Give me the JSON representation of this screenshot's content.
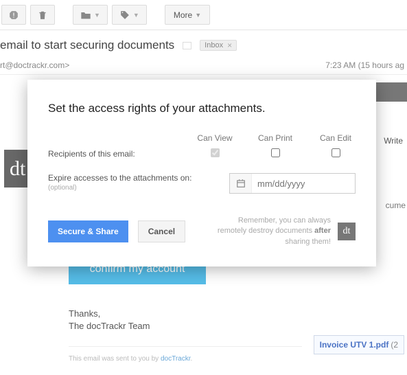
{
  "toolbar": {
    "more_label": "More"
  },
  "email": {
    "subject_fragment": "email to start securing documents",
    "inbox_label": "Inbox",
    "from_fragment": "rt@doctrackr.com>",
    "time_fragment": "7:23 AM (15 hours ag"
  },
  "right_rail": {
    "write_fragment": "Write",
    "cume_fragment": "cume"
  },
  "body": {
    "confirm_label": "confirm my account",
    "thanks_line1": "Thanks,",
    "thanks_line2": "The docTrackr Team",
    "footer_prefix": "This email was sent to you by ",
    "footer_link": "docTrackr",
    "footer_suffix": "."
  },
  "attachment": {
    "name": "Invoice UTV 1.pdf",
    "rest": "(2"
  },
  "modal": {
    "title": "Set the access rights of your attachments.",
    "col_view": "Can View",
    "col_print": "Can Print",
    "col_edit": "Can Edit",
    "recipients_label": "Recipients of this email:",
    "perm_view": true,
    "perm_print": false,
    "perm_edit": false,
    "expire_label": "Expire accesses to the attachments on:",
    "expire_optional": "(optional)",
    "date_placeholder": "mm/dd/yyyy",
    "secure_label": "Secure & Share",
    "cancel_label": "Cancel",
    "remember_pre": "Remember, you can always remotely destroy documents ",
    "remember_bold": "after",
    "remember_post": " sharing them!"
  },
  "logo": {
    "text": "dt"
  }
}
